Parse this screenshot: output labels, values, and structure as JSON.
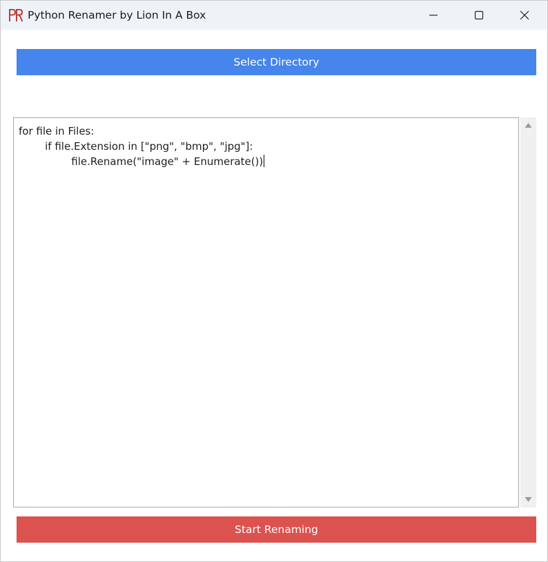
{
  "window": {
    "title": "Python Renamer by Lion In A Box",
    "icon": "pr-logo-icon"
  },
  "toolbar": {
    "select_directory_label": "Select Directory",
    "start_renaming_label": "Start Renaming"
  },
  "editor": {
    "lines": [
      "for file in Files:",
      "        if file.Extension in [\"png\", \"bmp\", \"jpg\"]:",
      "                file.Rename(\"image\" + Enumerate())"
    ]
  },
  "colors": {
    "titlebar": "#eef3f8",
    "select_button": "#4585ec",
    "start_button": "#db524f",
    "logo_red": "#c0282b"
  }
}
